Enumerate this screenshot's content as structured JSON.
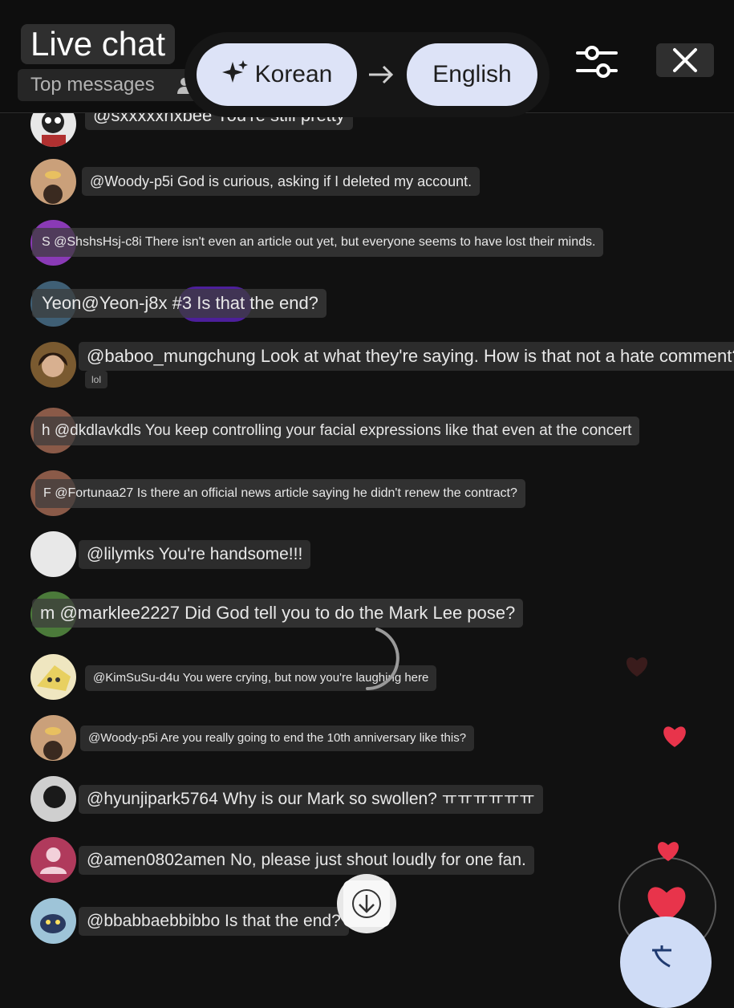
{
  "header": {
    "title": "Live chat",
    "filter_label": "Top messages",
    "translation": {
      "source_language": "Korean",
      "target_language": "English"
    },
    "icons": [
      "sparkle-icon",
      "arrow-right-icon",
      "filter-sliders-icon",
      "close-icon",
      "person-icon"
    ]
  },
  "messages": [
    {
      "author": "@sxxxxxnxbee",
      "text": "You're still pretty"
    },
    {
      "author": "@Woody-p5i",
      "text": "God is curious, asking if I deleted my account."
    },
    {
      "avatar_letter": "S",
      "author": "@ShshsHsj-c8i",
      "text": "There isn't even an article out yet, but everyone seems to have lost their minds."
    },
    {
      "avatar_letter": "Yeon",
      "author": "@Yeon-j8x",
      "text": "#3 Is that the end?"
    },
    {
      "author": "@baboo_mungchung",
      "text": "Look at what they're saying. How is that not a hate comment?",
      "sub_label": "lol"
    },
    {
      "avatar_letter": "h",
      "author": "@dkdlavkdls",
      "text": "You keep controlling your facial expressions like that even at the concert"
    },
    {
      "avatar_letter": "F",
      "author": "@Fortunaa27",
      "text": "Is there an official news article saying he didn't renew the contract?"
    },
    {
      "author": "@lilymks",
      "text": "You're handsome!!!"
    },
    {
      "avatar_letter": "m",
      "author": "@marklee2227",
      "text": "Did God tell you to do the Mark Lee pose?"
    },
    {
      "author": "@KimSuSu-d4u",
      "text": "You were crying, but now you're laughing here"
    },
    {
      "author": "@Woody-p5i",
      "text": "Are you really going to end the 10th anniversary like this?"
    },
    {
      "author": "@hyunjipark5764",
      "text": "Why is our Mark so swollen? ㅠㅠㅠㅠㅠㅠ"
    },
    {
      "author": "@amen0802amen",
      "text": "No, please just shout loudly for one fan."
    },
    {
      "author": "@bbabbaebbibbo",
      "text": "Is that the end?"
    }
  ],
  "colors": {
    "background": "#111111",
    "bubble": "#2c2c2c",
    "language_button": "#dde3f7",
    "highlight": "#6e28e6",
    "heart": "#e8344b",
    "translate_fab": "#cfdcf6"
  },
  "floating": {
    "scroll_down_icon": "arrow-down-icon",
    "reaction_icon": "heart-icon",
    "translate_icon": "translate-icon"
  }
}
